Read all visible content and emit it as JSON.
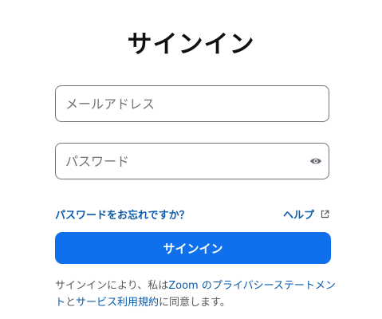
{
  "title": "サインイン",
  "email": {
    "placeholder": "メールアドレス",
    "value": ""
  },
  "password": {
    "placeholder": "パスワード",
    "value": "",
    "toggle_icon": "eye-icon"
  },
  "links": {
    "forgot_password": "パスワードをお忘れですか？",
    "help": "ヘルプ",
    "help_icon": "external-link-icon"
  },
  "signin_button": {
    "label": "サインイン"
  },
  "terms": {
    "prefix": "サインインにより、私は",
    "zoom_privacy": "Zoom のプライバシーステートメント",
    "joiner": "と",
    "terms_of_service": "サービス利用規約",
    "suffix": "に同意します。"
  },
  "colors": {
    "accent": "#0e71eb",
    "link": "#0b5cad",
    "title": "#111111",
    "muted_text": "#555a60",
    "field_border": "#6e7680"
  }
}
